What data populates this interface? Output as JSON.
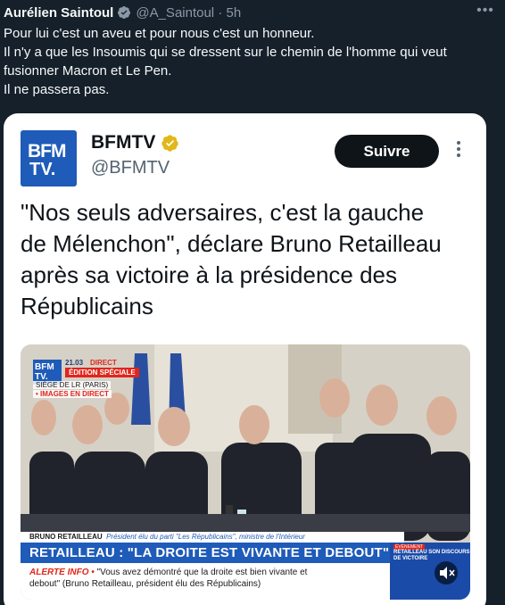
{
  "tweet": {
    "author_name": "Aurélien Saintoul",
    "handle": "@A_Saintoul",
    "separator": "·",
    "time": "5h",
    "more_icon": "more-horizontal-icon",
    "verified_color": "#1d9bf0",
    "lines": [
      "Pour lui c'est un aveu et pour nous c'est un honneur.",
      "Il n'y a que les Insoumis qui se dressent sur le chemin de l'homme qui veut",
      "fusionner Macron et Le Pen.",
      "Il ne passera pas."
    ]
  },
  "quoted": {
    "logo_line1": "BFM",
    "logo_line2": "TV.",
    "name": "BFMTV",
    "handle": "@BFMTV",
    "follow_label": "Suivre",
    "verified_color": "#e2b719",
    "text_lines": [
      "\"Nos seuls adversaires, c'est la gauche",
      "de Mélenchon\", déclare Bruno Retailleau",
      "après sa victoire à la présidence des",
      "Républicains"
    ],
    "media": {
      "logo_line1": "BFM",
      "logo_line2": "TV.",
      "time": "21.03",
      "direct": "DIRECT",
      "edition": "ÉDITION SPÉCIALE",
      "location": "SIÈGE DE LR (PARIS)",
      "images_direct": "• IMAGES EN DIRECT",
      "lower_name": "BRUNO RETAILLEAU",
      "lower_role": "Président élu du parti \"Les Républicains\", ministre de l'Intérieur",
      "headline": "RETAILLEAU : \"LA DROITE EST VIVANTE ET DEBOUT\"",
      "alert_label": "ALERTE INFO •",
      "alert_quote": "\"Vous avez démontré que la droite est bien vivante et",
      "alert_quote2": "debout\" (Bruno Retailleau, président élu des Républicains)",
      "side_tag": "ÉVÉNEMENT",
      "side_text": "RETAILLEAU SON DISCOURS DE VICTOIRE",
      "mute_icon": "speaker-muted-icon"
    }
  }
}
